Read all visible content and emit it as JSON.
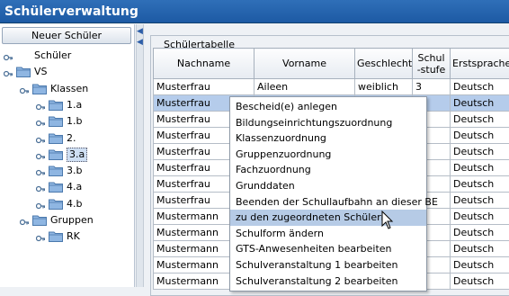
{
  "app": {
    "title": "Schülerverwaltung"
  },
  "left": {
    "new_button": "Neuer Schüler",
    "tree": [
      {
        "label": "Schüler",
        "level": 0
      },
      {
        "label": "VS",
        "level": 0
      },
      {
        "label": "Klassen",
        "level": 1
      },
      {
        "label": "1.a",
        "level": 2
      },
      {
        "label": "1.b",
        "level": 2
      },
      {
        "label": "2.",
        "level": 2
      },
      {
        "label": "3.a",
        "level": 2,
        "selected": true
      },
      {
        "label": "3.b",
        "level": 2
      },
      {
        "label": "4.a",
        "level": 2
      },
      {
        "label": "4.b",
        "level": 2
      },
      {
        "label": "Gruppen",
        "level": 1
      },
      {
        "label": "RK",
        "level": 2
      }
    ]
  },
  "table": {
    "title": "Schülertabelle",
    "columns": [
      "Nachname",
      "Vorname",
      "Geschlecht",
      "Schul\n-stufe",
      "Erstsprache"
    ],
    "rows": [
      [
        "Musterfrau",
        "Aileen",
        "weiblich",
        "3",
        "Deutsch"
      ],
      [
        "Musterfrau",
        "",
        "",
        "",
        "Deutsch"
      ],
      [
        "Musterfrau",
        "",
        "",
        "",
        "Deutsch"
      ],
      [
        "Musterfrau",
        "",
        "",
        "",
        "Deutsch"
      ],
      [
        "Musterfrau",
        "",
        "",
        "",
        "Deutsch"
      ],
      [
        "Musterfrau",
        "",
        "",
        "",
        "Deutsch"
      ],
      [
        "Musterfrau",
        "",
        "",
        "",
        "Deutsch"
      ],
      [
        "Musterfrau",
        "",
        "",
        "",
        "Deutsch"
      ],
      [
        "Mustermann",
        "",
        "",
        "",
        "Deutsch"
      ],
      [
        "Mustermann",
        "",
        "",
        "",
        "Deutsch"
      ],
      [
        "Mustermann",
        "",
        "",
        "",
        "Deutsch"
      ],
      [
        "Mustermann",
        "",
        "",
        "",
        "Deutsch"
      ],
      [
        "Mustermann",
        "",
        "",
        "",
        "Deutsch"
      ]
    ],
    "selected_row": 1
  },
  "context_menu": {
    "items": [
      "Bescheid(e) anlegen",
      "Bildungseinrichtungszuordnung",
      "Klassenzuordnung",
      "Gruppenzuordnung",
      "Fachzuordnung",
      "Grunddaten",
      "Beenden der Schullaufbahn an dieser BE",
      "zu den zugeordneten Schülern",
      "Schulform ändern",
      "GTS-Anwesenheiten bearbeiten",
      "Schulveranstaltung 1 bearbeiten",
      "Schulveranstaltung 2 bearbeiten"
    ],
    "highlighted_index": 7
  },
  "icons": {
    "tree_key": "key-icon",
    "tree_folder": "folder-icon",
    "splitter_arrows": "chevron-left-icon",
    "cursor": "mouse-pointer-icon"
  },
  "colors": {
    "titlebar": "#1d5aa4",
    "selection": "#b5cceb",
    "menu_highlight": "#b6cbe6"
  }
}
